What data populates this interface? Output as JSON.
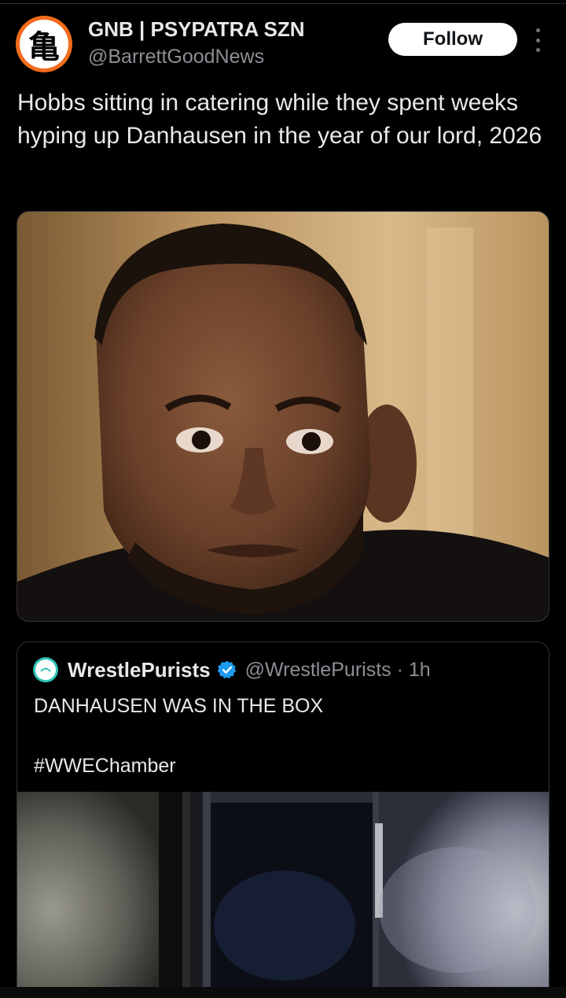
{
  "tweet": {
    "author": {
      "display_name": "GNB | PSYPATRA SZN",
      "handle": "@BarrettGoodNews",
      "avatar_glyph": "亀",
      "avatar_ring_color": "#f26b1d"
    },
    "follow_label": "Follow",
    "more_icon": "more-vertical-icon",
    "text": "Hobbs sitting in catering while they spent weeks hyping up Danhausen in the year of our lord, 2026",
    "media": {
      "type": "photo"
    }
  },
  "quote": {
    "author": {
      "display_name": "WrestlePurists",
      "handle_time": "@WrestlePurists · 1h",
      "avatar_color": "#2ec4b6",
      "verified_icon": "verified-badge-icon",
      "verified_color": "#1d9bf0"
    },
    "text_line1": "DANHAUSEN WAS IN THE BOX",
    "text_line2": "#WWEChamber",
    "media": {
      "type": "video-thumbnail"
    }
  }
}
